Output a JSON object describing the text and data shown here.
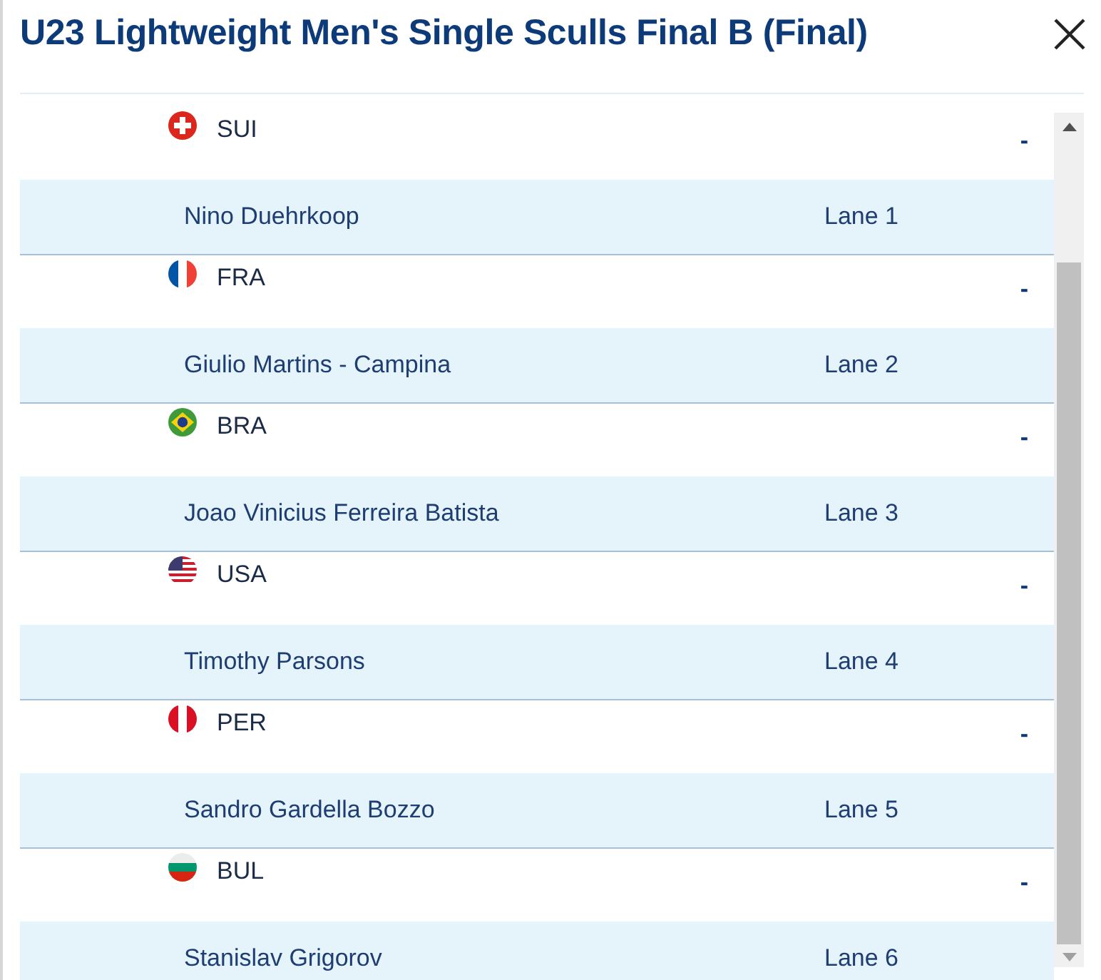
{
  "title": "U23 Lightweight Men's Single Sculls Final B (Final)",
  "entries": [
    {
      "country": "SUI",
      "kind": "swiss",
      "result": "-",
      "athlete": "Nino Duehrkoop",
      "lane": "Lane 1"
    },
    {
      "country": "FRA",
      "kind": "vertical-tricolor",
      "result": "-",
      "athlete": "Giulio Martins - Campina",
      "lane": "Lane 2"
    },
    {
      "country": "BRA",
      "kind": "brazil",
      "result": "-",
      "athlete": "Joao Vinicius Ferreira Batista",
      "lane": "Lane 3"
    },
    {
      "country": "USA",
      "kind": "stars-stripes",
      "result": "-",
      "athlete": "Timothy Parsons",
      "lane": "Lane 4"
    },
    {
      "country": "PER",
      "kind": "peru",
      "result": "-",
      "athlete": "Sandro Gardella Bozzo",
      "lane": "Lane 5"
    },
    {
      "country": "BUL",
      "kind": "bulgaria",
      "result": "-",
      "athlete": "Stanislav Grigorov",
      "lane": "Lane 6"
    }
  ]
}
